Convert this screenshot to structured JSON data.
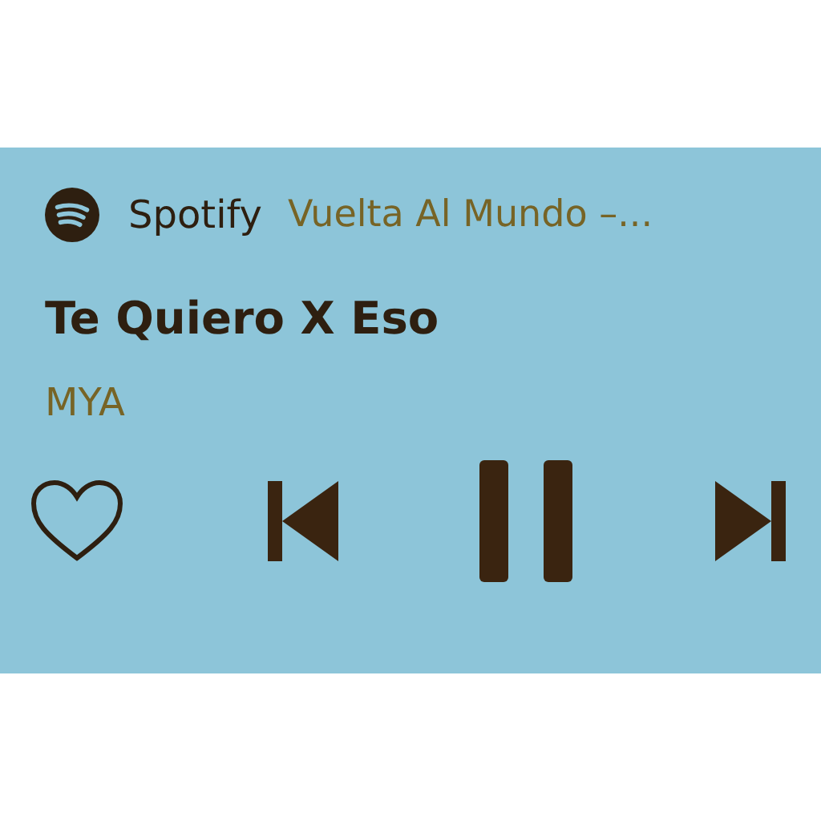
{
  "app": {
    "name": "Spotify",
    "context": "Vuelta Al Mundo –..."
  },
  "track": {
    "title": "Te Quiero X Eso",
    "artist": "MYA"
  },
  "controls": {
    "liked": false,
    "playing": true
  }
}
